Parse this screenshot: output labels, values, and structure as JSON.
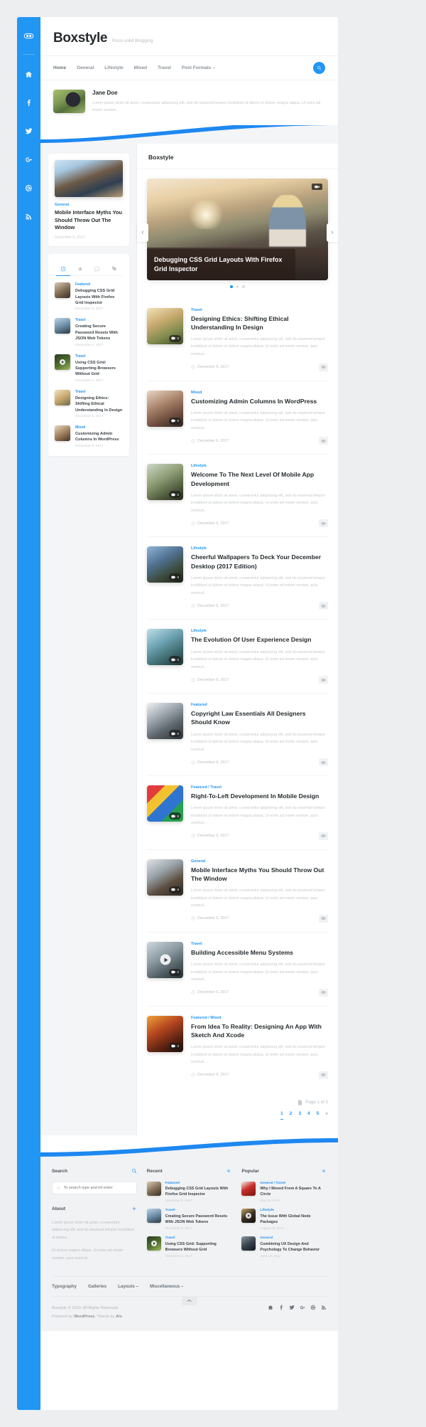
{
  "rail": {
    "logo_icon": "toggle-logo-icon",
    "items": [
      {
        "name": "home-icon",
        "glyph": "home"
      },
      {
        "name": "facebook-icon",
        "glyph": "facebook"
      },
      {
        "name": "twitter-icon",
        "glyph": "twitter"
      },
      {
        "name": "google-plus-icon",
        "glyph": "gplus"
      },
      {
        "name": "dribbble-icon",
        "glyph": "dribbble"
      },
      {
        "name": "rss-icon",
        "glyph": "rss"
      }
    ]
  },
  "header": {
    "site_title": "Boxstyle",
    "tagline": "Rock-solid Blogging",
    "nav": [
      "Home",
      "General",
      "Lifestyle",
      "Mixed",
      "Travel",
      "Post Formats –"
    ],
    "search_icon": "search-icon"
  },
  "bio": {
    "name": "Jane Doe",
    "text": "Lorem ipsum dolor sit amet, consectetur adipiscing elit, sed do eiusmod tempor incididunt ut labore et dolore magna aliqua. Ut enim ad minim veniam."
  },
  "sidebar": {
    "featured": {
      "category": "General",
      "title": "Mobile Interface Myths You Should Throw Out The Window",
      "date": "December 5, 2017"
    },
    "tabs": [
      {
        "name": "tab-recent",
        "icon": "clock-icon",
        "active": true
      },
      {
        "name": "tab-popular",
        "icon": "star-icon",
        "active": false
      },
      {
        "name": "tab-comments",
        "icon": "comment-icon",
        "active": false
      },
      {
        "name": "tab-tags",
        "icon": "tag-icon",
        "active": false
      }
    ],
    "recent": [
      {
        "category": "Featured",
        "title": "Debugging CSS Grid Layouts With Firefox Grid Inspector",
        "date": "December 6, 2017"
      },
      {
        "category": "Travel",
        "title": "Creating Secure Password Resets With JSON Web Tokens",
        "date": "December 6, 2017"
      },
      {
        "category": "Travel",
        "title": "Using CSS Grid: Supporting Browsers Without Grid",
        "date": "December 6, 2017"
      },
      {
        "category": "Travel",
        "title": "Designing Ethics: Shifting Ethical Understanding In Design",
        "date": "December 6, 2017"
      },
      {
        "category": "Mixed",
        "title": "Customizing Admin Columns In WordPress",
        "date": "December 6, 2017"
      }
    ]
  },
  "main": {
    "heading": "Boxstyle",
    "hero": {
      "title": "Debugging CSS Grid Layouts With Firefox Grid Inspector",
      "format_icon": "gallery-icon",
      "prev_arrow": "‹",
      "next_arrow": "›",
      "dots": 3,
      "active_dot": 0
    },
    "posts": [
      {
        "category": "Travel",
        "title": "Designing Ethics: Shifting Ethical Understanding In Design",
        "excerpt": "Lorem ipsum dolor sit amet, consectetur adipiscing elit, sed do eiusmod tempor incididunt ut labore et dolore magna aliqua. Ut enim ad minim veniam, quis nostrud...",
        "date": "December 6, 2017",
        "badge": "0",
        "badge_icon": "comment-icon",
        "format": "image"
      },
      {
        "category": "Mixed",
        "title": "Customizing Admin Columns In WordPress",
        "excerpt": "Lorem ipsum dolor sit amet, consectetur adipiscing elit, sed do eiusmod tempor incididunt ut labore et dolore magna aliqua. Ut enim ad minim veniam, quis nostrud...",
        "date": "December 6, 2017",
        "badge": "0",
        "badge_icon": "comment-icon",
        "format": "image"
      },
      {
        "category": "Lifestyle",
        "title": "Welcome To The Next Level Of Mobile App Development",
        "excerpt": "Lorem ipsum dolor sit amet, consectetur adipiscing elit, sed do eiusmod tempor incididunt ut labore et dolore magna aliqua. Ut enim ad minim veniam, quis nostrud...",
        "date": "December 6, 2017",
        "badge": "0",
        "badge_icon": "comment-icon",
        "format": "image"
      },
      {
        "category": "Lifestyle",
        "title": "Cheerful Wallpapers To Deck Your December Desktop (2017 Edition)",
        "excerpt": "Lorem ipsum dolor sit amet, consectetur adipiscing elit, sed do eiusmod tempor incididunt ut labore et dolore magna aliqua. Ut enim ad minim veniam, quis nostrud...",
        "date": "December 6, 2017",
        "badge": "0",
        "badge_icon": "comment-icon",
        "format": "image"
      },
      {
        "category": "Lifestyle",
        "title": "The Evolution Of User Experience Design",
        "excerpt": "Lorem ipsum dolor sit amet, consectetur adipiscing elit, sed do eiusmod tempor incididunt ut labore et dolore magna aliqua. Ut enim ad minim veniam, quis nostrud...",
        "date": "December 6, 2017",
        "badge": "0",
        "badge_icon": "comment-icon",
        "format": "image"
      },
      {
        "category": "Featured",
        "title": "Copyright Law Essentials All Designers Should Know",
        "excerpt": "Lorem ipsum dolor sit amet, consectetur adipiscing elit, sed do eiusmod tempor incididunt ut labore et dolore magna aliqua. Ut enim ad minim veniam, quis nostrud...",
        "date": "December 6, 2017",
        "badge": "0",
        "badge_icon": "comment-icon",
        "format": "image"
      },
      {
        "category": "Featured / Travel",
        "title": "Right-To-Left Development In Mobile Design",
        "excerpt": "Lorem ipsum dolor sit amet, consectetur adipiscing elit, sed do eiusmod tempor incididunt ut labore et dolore magna aliqua. Ut enim ad minim veniam, quis nostrud...",
        "date": "December 6, 2017",
        "badge": "0",
        "badge_icon": "comment-icon",
        "format": "image"
      },
      {
        "category": "General",
        "title": "Mobile Interface Myths You Should Throw Out The Window",
        "excerpt": "Lorem ipsum dolor sit amet, consectetur adipiscing elit, sed do eiusmod tempor incididunt ut labore et dolore magna aliqua. Ut enim ad minim veniam, quis nostrud...",
        "date": "December 5, 2017",
        "badge": "0",
        "badge_icon": "comment-icon",
        "format": "image"
      },
      {
        "category": "Travel",
        "title": "Building Accessible Menu Systems",
        "excerpt": "Lorem ipsum dolor sit amet, consectetur adipiscing elit, sed do eiusmod tempor incididunt ut labore et dolore magna aliqua. Ut enim ad minim veniam, quis nostrud...",
        "date": "December 5, 2017",
        "badge": "0",
        "badge_icon": "comment-icon",
        "format": "video"
      },
      {
        "category": "Featured / Mixed",
        "title": "From Idea To Reality: Designing An App With Sketch And Xcode",
        "excerpt": "Lorem ipsum dolor sit amet, consectetur adipiscing elit, sed do eiusmod tempor incididunt ut labore et dolore magna aliqua. Ut enim ad minim veniam, quis nostrud...",
        "date": "December 5, 2017",
        "badge": "0",
        "badge_icon": "comment-icon",
        "format": "image"
      }
    ],
    "pagination": {
      "page_label": "Page 1 of 5",
      "page_icon": "document-icon",
      "items": [
        "1",
        "2",
        "3",
        "4",
        "5",
        "»"
      ],
      "current": "1"
    }
  },
  "footer": {
    "search": {
      "title": "Search",
      "icon": "search-icon",
      "placeholder": "To search type and hit enter",
      "value": ""
    },
    "about": {
      "title": "About",
      "icon": "plus-icon",
      "p1": "Lorem ipsum dolor sit amet, consectetur adipiscing elit, sed do eiusmod tempor incididunt ut labore.",
      "p2": "Et dolore magna aliqua. Ut enim ad minim veniam, quis nostrud."
    },
    "recent": {
      "title": "Recent",
      "icon": "plus-icon",
      "items": [
        {
          "category": "Featured",
          "title": "Debugging CSS Grid Layouts With Firefox Grid Inspector",
          "date": "December 6, 2017",
          "format": "image"
        },
        {
          "category": "Travel",
          "title": "Creating Secure Password Resets With JSON Web Tokens",
          "date": "December 6, 2017",
          "format": "image"
        },
        {
          "category": "Travel",
          "title": "Using CSS Grid: Supporting Browsers Without Grid",
          "date": "December 6, 2017",
          "format": "video"
        }
      ]
    },
    "popular": {
      "title": "Popular",
      "icon": "plus-icon",
      "items": [
        {
          "category": "General / Travel",
          "title": "Why I Moved From A Square To A Circle",
          "date": "May 28, 2014",
          "format": "image"
        },
        {
          "category": "Lifestyle",
          "title": "The Issue With Global Node Packages",
          "date": "August 15, 2013",
          "format": "video"
        },
        {
          "category": "General",
          "title": "Combining UX Design And Psychology To Change Behavior",
          "date": "June 13, 2014",
          "format": "image"
        }
      ]
    },
    "nav": [
      "Typography",
      "Galleries",
      "Layouts –",
      "Miscellaneous –"
    ],
    "copyright_line1": "Boxstyle © 2019. All Rights Reserved.",
    "copyright_prefix": "Powered by ",
    "copyright_wp": "WordPress",
    "copyright_mid": ". Theme by ",
    "copyright_alx": "Alx",
    "copyright_suffix": ".",
    "to_top_icon": "chevron-up-icon",
    "social": [
      "home-icon",
      "facebook-icon",
      "twitter-icon",
      "google-plus-icon",
      "dribbble-icon",
      "rss-icon"
    ]
  },
  "colors": {
    "accent": "#2196f3",
    "text": "#262b2e",
    "muted": "#b9bfc4",
    "page_bg": "#eceef0"
  }
}
